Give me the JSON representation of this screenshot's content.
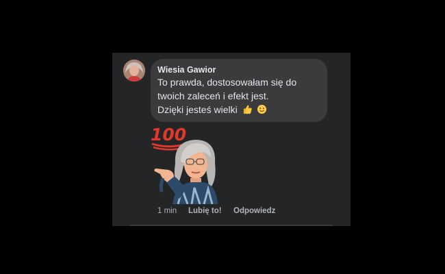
{
  "comment": {
    "author": "Wiesia Gawior",
    "lines": [
      "To prawda, dostosowałam się do",
      "twoich zaleceń i efekt jest.",
      "Dzięki jesteś wielki"
    ],
    "emoji": [
      "thumbs-up-icon",
      "smiley-face-icon"
    ],
    "sticker": {
      "name": "memoji-pointing-sticker",
      "badge": "100"
    }
  },
  "actions": {
    "time": "1 min",
    "like": "Lubię to!",
    "reply": "Odpowiedz"
  },
  "colors": {
    "panel": "#242526",
    "bubble": "#3a3b3c",
    "text": "#e4e6eb",
    "muted": "#b0b3b8",
    "badge": "#e0392b"
  }
}
